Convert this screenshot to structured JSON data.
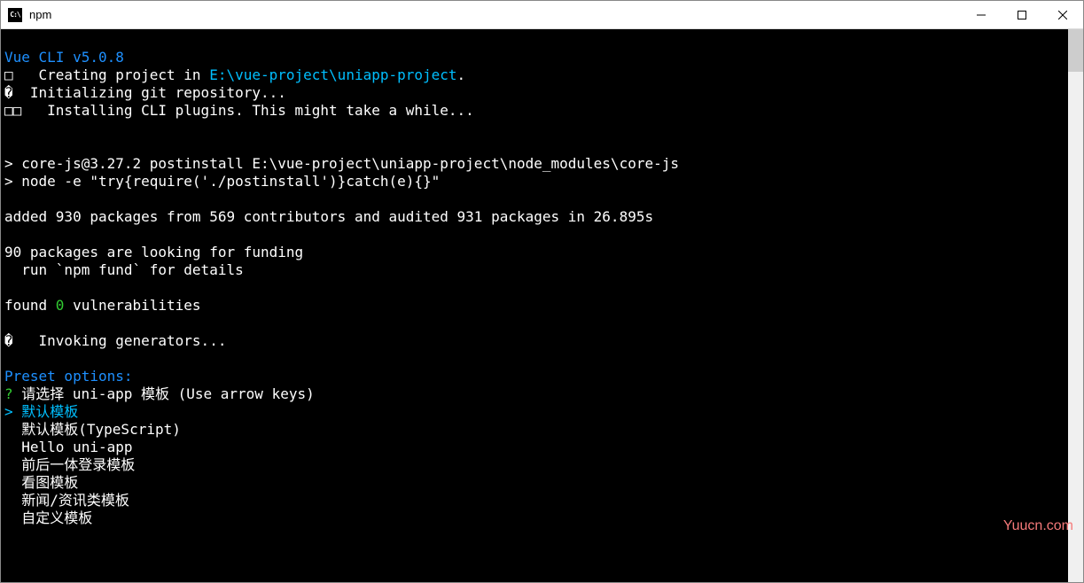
{
  "window": {
    "title": "npm"
  },
  "header": {
    "vue_cli_version": "Vue CLI v5.0.8"
  },
  "lines": {
    "creating_prefix": "□   Creating project in ",
    "creating_path": "E:\\vue-project\\uniapp-project",
    "creating_suffix": ".",
    "init_git": "�  Initializing git repository...",
    "installing": "□□   Installing CLI plugins. This might take a while...",
    "postinstall": "> core-js@3.27.2 postinstall E:\\vue-project\\uniapp-project\\node_modules\\core-js",
    "node_cmd": "> node -e \"try{require('./postinstall')}catch(e){}\"",
    "added": "added 930 packages from 569 contributors and audited 931 packages in 26.895s",
    "funding1": "90 packages are looking for funding",
    "funding2": "  run `npm fund` for details",
    "found_prefix": "found ",
    "found_count": "0",
    "found_suffix": " vulnerabilities",
    "invoking": "�   Invoking generators...",
    "preset_options": "Preset options:",
    "prompt_q": "?",
    "prompt_text": " 请选择 uni-app 模板 (Use arrow keys)",
    "selector": ">"
  },
  "templates": [
    {
      "label": "默认模板",
      "selected": true
    },
    {
      "label": "默认模板(TypeScript)",
      "selected": false
    },
    {
      "label": "Hello uni-app",
      "selected": false
    },
    {
      "label": "前后一体登录模板",
      "selected": false
    },
    {
      "label": "看图模板",
      "selected": false
    },
    {
      "label": "新闻/资讯类模板",
      "selected": false
    },
    {
      "label": "自定义模板",
      "selected": false
    }
  ],
  "watermark": "Yuucn.com"
}
